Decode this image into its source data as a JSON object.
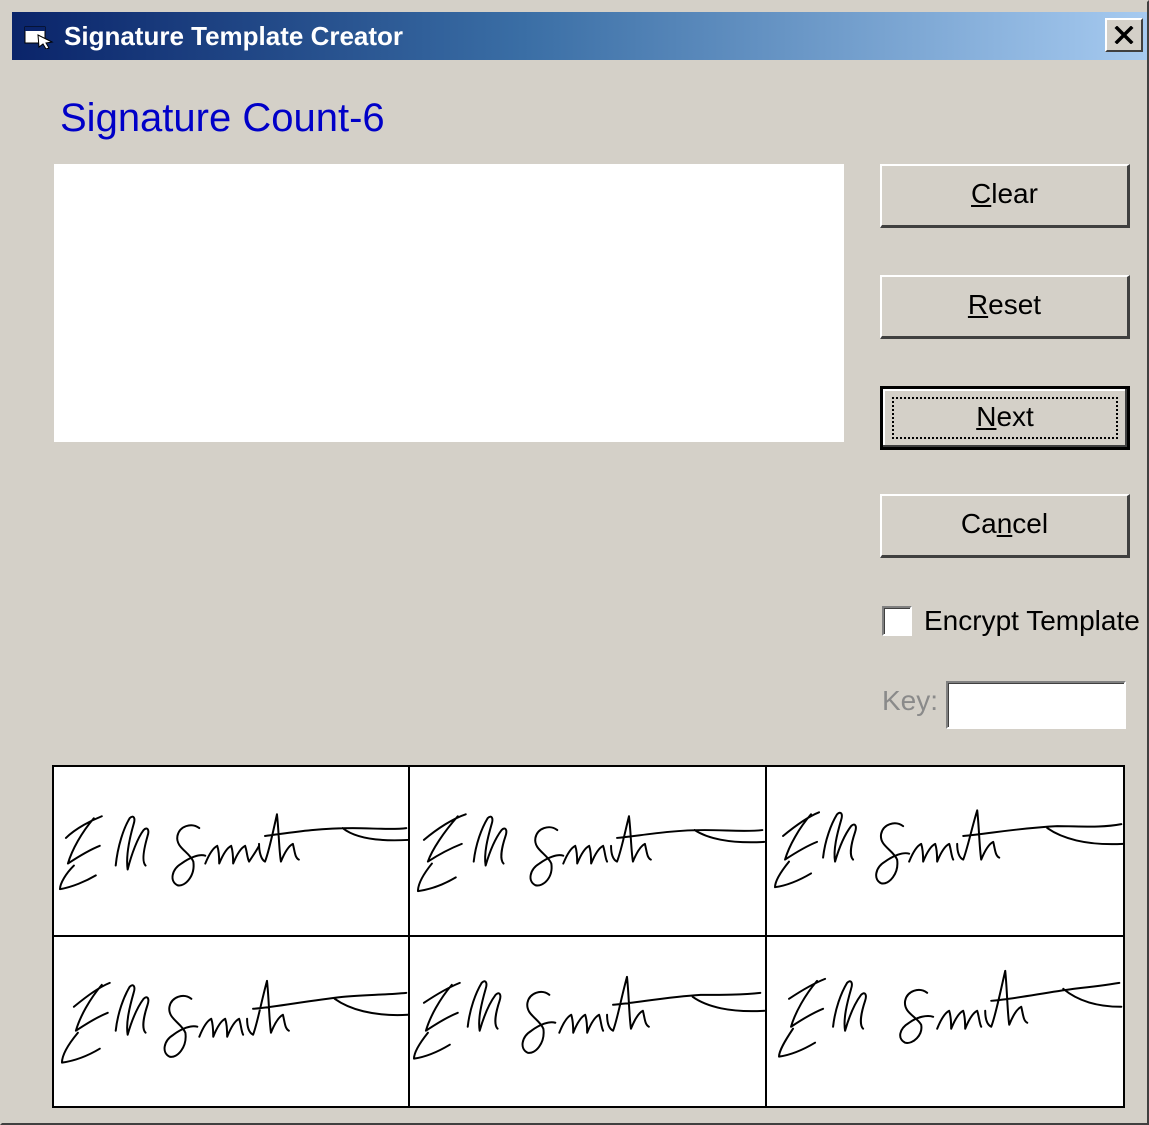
{
  "window": {
    "title": "Signature Template Creator",
    "title_icon": "app-window-icon",
    "close_icon": "close-icon"
  },
  "signature_count_label": "Signature Count-6",
  "buttons": {
    "clear": {
      "pre": "",
      "key": "C",
      "post": "lear"
    },
    "reset": {
      "pre": "",
      "key": "R",
      "post": "eset"
    },
    "next": {
      "pre": "",
      "key": "N",
      "post": "ext"
    },
    "cancel": {
      "pre": "Ca",
      "key": "n",
      "post": "cel"
    }
  },
  "encrypt_template": {
    "label": "Encrypt Template",
    "checked": false
  },
  "key_field": {
    "label": "Key:",
    "value": ""
  },
  "signatures": {
    "count": 6,
    "columns": 3,
    "rows": 2
  },
  "colors": {
    "dialog_bg": "#d4d0c8",
    "title_gradient_start": "#0a246a",
    "title_gradient_end": "#a6caf0",
    "count_label": "#0000c8",
    "disabled_text": "#8a8a8a"
  }
}
